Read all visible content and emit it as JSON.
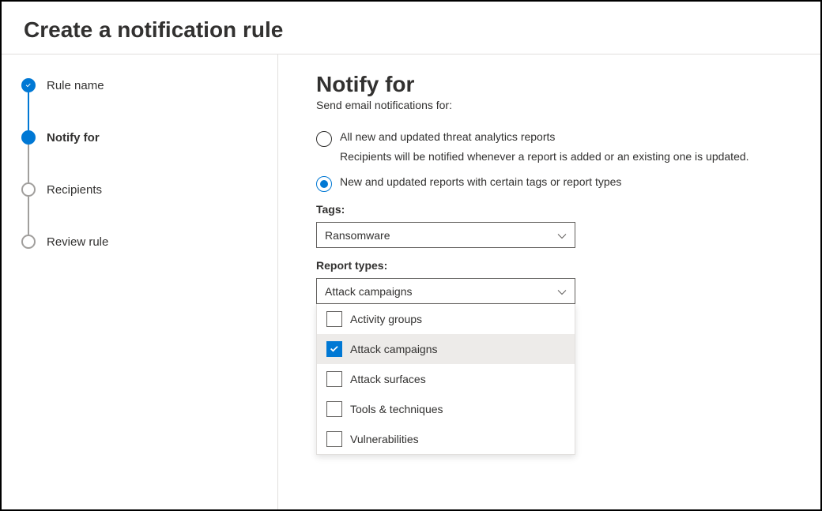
{
  "header": {
    "title": "Create a notification rule"
  },
  "steps": [
    {
      "label": "Rule name",
      "state": "completed"
    },
    {
      "label": "Notify for",
      "state": "current"
    },
    {
      "label": "Recipients",
      "state": "pending"
    },
    {
      "label": "Review rule",
      "state": "pending"
    }
  ],
  "main": {
    "heading": "Notify for",
    "subheading": "Send email notifications for:",
    "radios": [
      {
        "label": "All new and updated threat analytics reports",
        "description": "Recipients will be notified whenever a report is added or an existing one is updated.",
        "selected": false
      },
      {
        "label": "New and updated reports with certain tags or report types",
        "selected": true
      }
    ],
    "tags": {
      "label": "Tags:",
      "selected": "Ransomware"
    },
    "reportTypes": {
      "label": "Report types:",
      "selected": "Attack campaigns",
      "options": [
        {
          "label": "Activity groups",
          "checked": false
        },
        {
          "label": "Attack campaigns",
          "checked": true
        },
        {
          "label": "Attack surfaces",
          "checked": false
        },
        {
          "label": "Tools & techniques",
          "checked": false
        },
        {
          "label": "Vulnerabilities",
          "checked": false
        }
      ]
    }
  }
}
